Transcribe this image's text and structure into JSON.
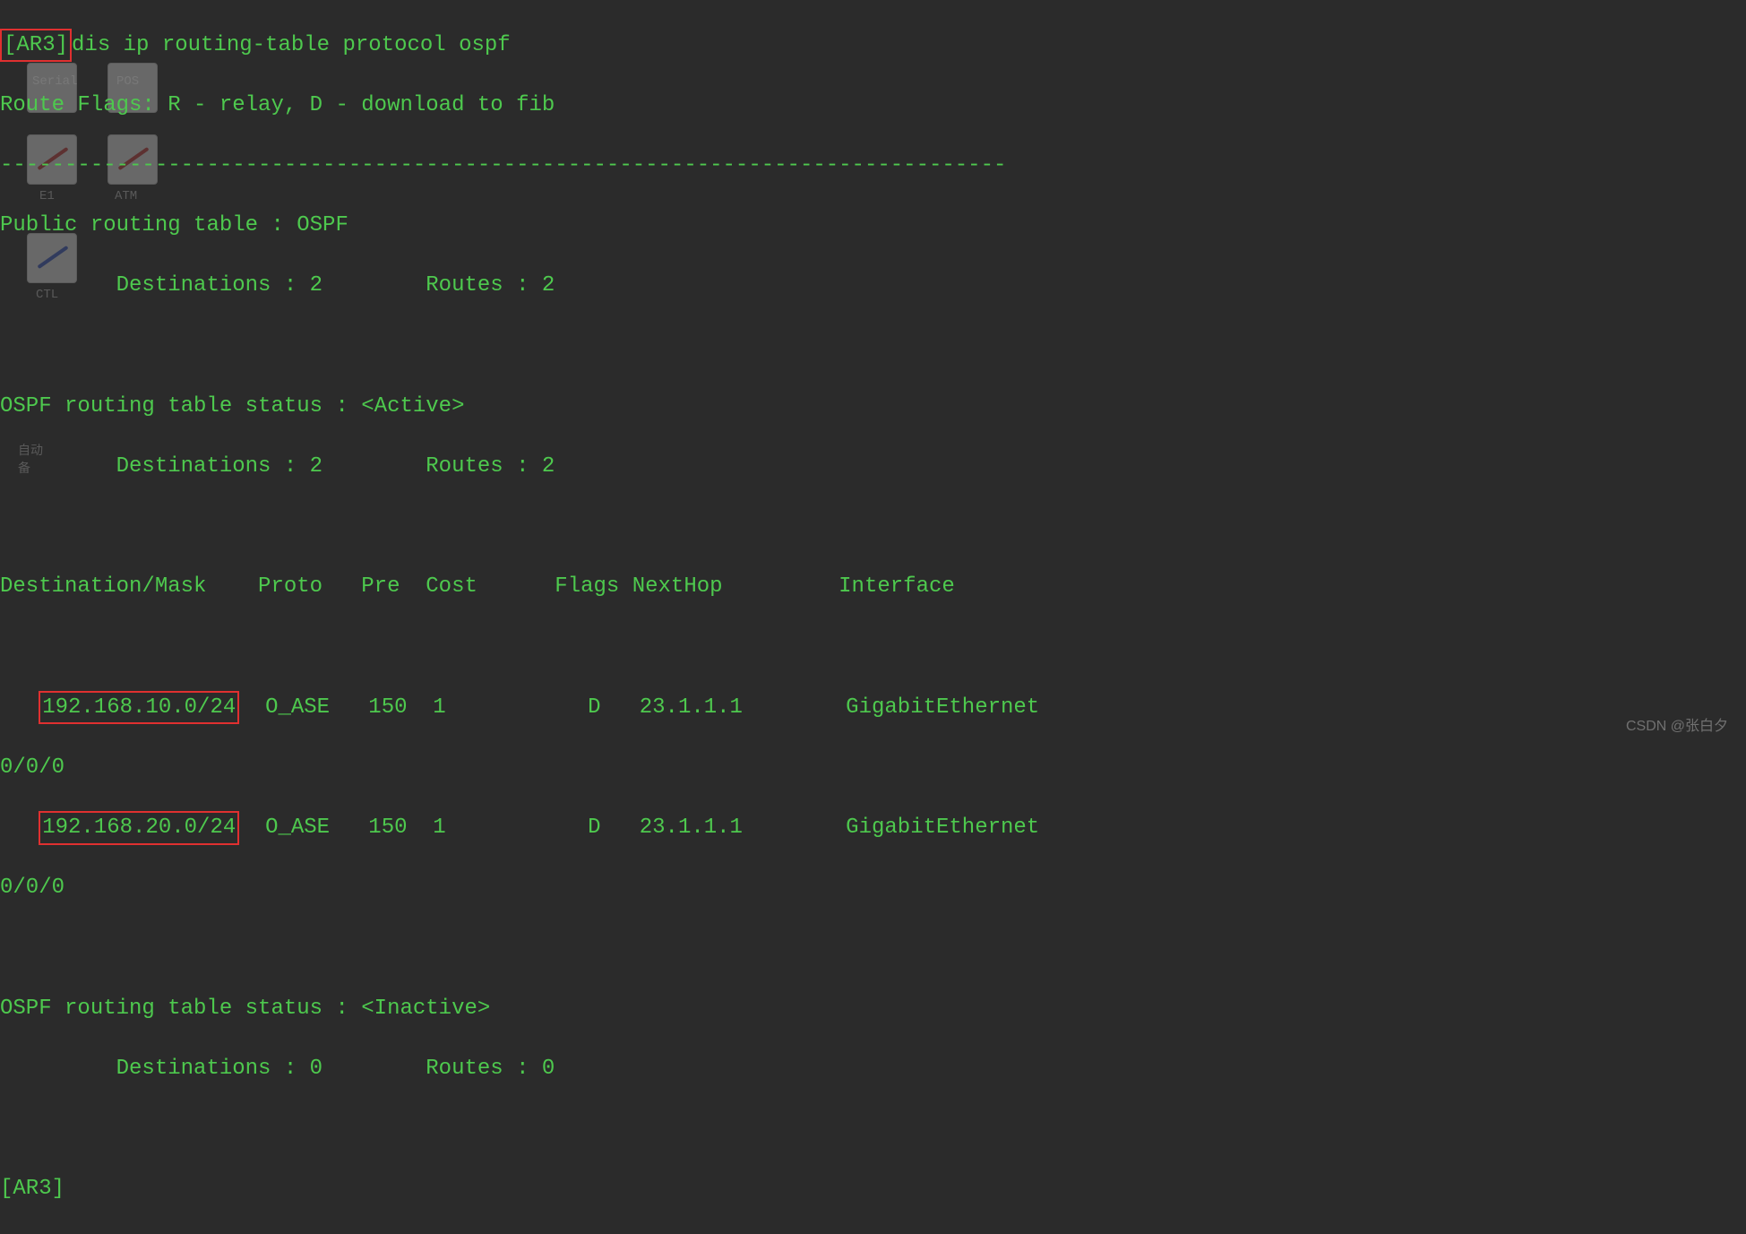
{
  "bg_icons": {
    "serial_label": "Serial",
    "pos_label": "POS",
    "e1_label": "E1",
    "atm_label": "ATM",
    "ctl_label": "CTL",
    "auto_label": "自动",
    "label2": "备"
  },
  "prompt1": "[AR3]",
  "command1": "dis ip routing-table protocol ospf",
  "flags_line": "Route Flags: R - relay, D - download to fib",
  "separator": "------------------------------------------------------------------------------",
  "public_table": "Public routing table : OSPF",
  "public_dests": "         Destinations : 2        Routes : 2",
  "active_status": "OSPF routing table status : <Active>",
  "active_dests": "         Destinations : 2        Routes : 2",
  "headers": "Destination/Mask    Proto   Pre  Cost      Flags NextHop         Interface",
  "route1_pre": "   ",
  "route1_dest": "192.168.10.0/24",
  "route1_rest": "  O_ASE   150  1           D   23.1.1.1        GigabitEthernet",
  "route1_iface": "0/0/0",
  "route2_pre": "   ",
  "route2_dest": "192.168.20.0/24",
  "route2_rest": "  O_ASE   150  1           D   23.1.1.1        GigabitEthernet",
  "route2_iface": "0/0/0",
  "inactive_status": "OSPF routing table status : <Inactive>",
  "inactive_dests": "         Destinations : 0        Routes : 0",
  "prompt2": "[AR3]",
  "watermark": "CSDN @张白夕"
}
